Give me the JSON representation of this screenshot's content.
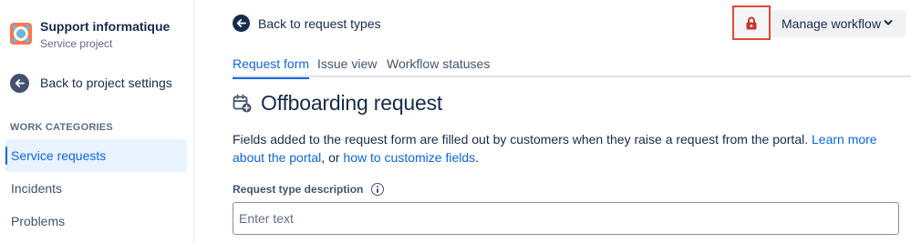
{
  "project": {
    "name": "Support informatique",
    "type": "Service project",
    "avatar_icon": "lifebuoy-icon"
  },
  "sidebar": {
    "back_label": "Back to project settings",
    "section_title": "WORK CATEGORIES",
    "items": [
      {
        "label": "Service requests",
        "active": true
      },
      {
        "label": "Incidents",
        "active": false
      },
      {
        "label": "Problems",
        "active": false
      }
    ]
  },
  "header": {
    "back_label": "Back to request types",
    "lock_icon": "lock-icon",
    "manage_workflow_label": "Manage workflow"
  },
  "tabs": [
    {
      "label": "Request form",
      "active": true
    },
    {
      "label": "Issue view",
      "active": false
    },
    {
      "label": "Workflow statuses",
      "active": false
    }
  ],
  "page": {
    "title": "Offboarding request",
    "title_icon": "calendar-add-icon",
    "description_prefix": "Fields added to the request form are filled out by customers when they raise a request from the portal.",
    "learn_more_link": "Learn more about the portal",
    "description_middle": ", or",
    "customize_link": "how to customize fields",
    "description_suffix": "."
  },
  "form": {
    "description_label": "Request type description",
    "description_placeholder": "Enter text",
    "description_value": ""
  },
  "colors": {
    "accent": "#0c66e4",
    "lock_border": "#e34935",
    "lock_icon": "#c9372c",
    "text": "#172b4d"
  }
}
